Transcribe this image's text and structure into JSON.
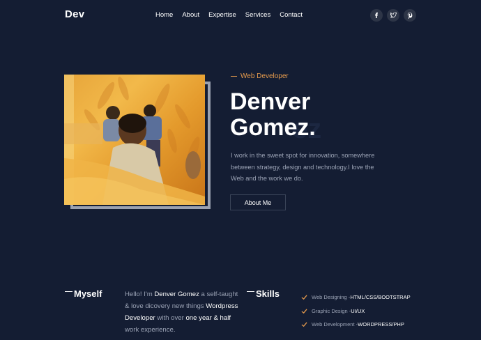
{
  "brand": {
    "logo": "Dev"
  },
  "nav": {
    "items": [
      "Home",
      "About",
      "Expertise",
      "Services",
      "Contact"
    ]
  },
  "social": {
    "icons": [
      "facebook-icon",
      "twitter-icon",
      "pinterest-icon"
    ]
  },
  "hero": {
    "pretitle": "Web Developer",
    "name_line1": "Denver",
    "name_line2": "Gomez.",
    "ghost_text": "ez",
    "intro": "I work in the sweet spot for innovation, somewhere between strategy, design and technology.I love the Web and the work we do.",
    "button": "About Me"
  },
  "myself": {
    "heading": "Myself",
    "t1": "Hello! I'm ",
    "b1": "Denver Gomez",
    "t2": " a self-taught & love dicovery new things ",
    "b2": "Wordpress Developer",
    "t3": " with over ",
    "b3": "one year & half",
    "t4": " work experience."
  },
  "skills": {
    "heading": "Skills",
    "items": [
      {
        "label": "Web Designing - ",
        "value": "HTML/CSS/BOOTSTRAP"
      },
      {
        "label": "Graphic Design - ",
        "value": "UI/UX"
      },
      {
        "label": "Web Development - ",
        "value": "WORDPRESS/PHP"
      }
    ]
  },
  "colors": {
    "background": "#141d33",
    "accent": "#e59a4c",
    "muted_text": "#9ba3b5"
  }
}
